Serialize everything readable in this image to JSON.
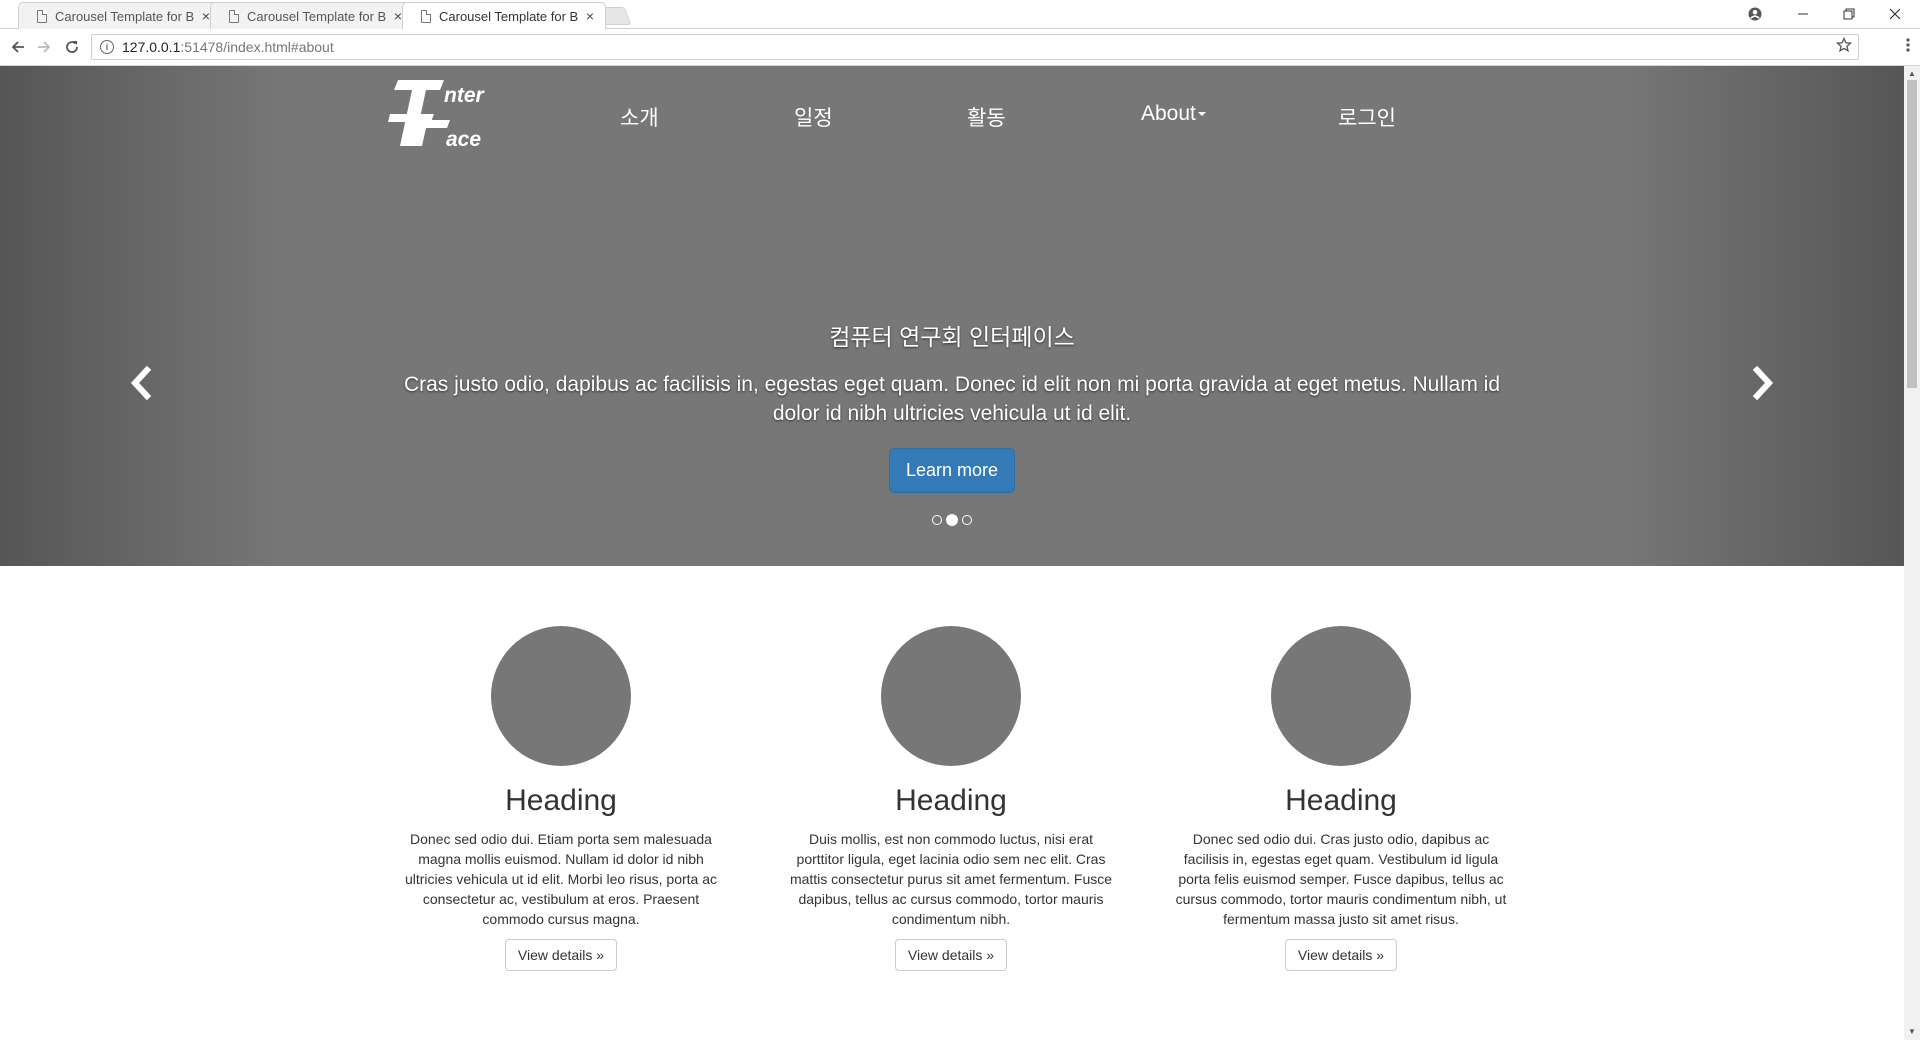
{
  "browser": {
    "tabs": [
      {
        "title": "Carousel Template for B",
        "active": false
      },
      {
        "title": "Carousel Template for B",
        "active": false
      },
      {
        "title": "Carousel Template for B",
        "active": true
      }
    ],
    "tab_close": "×",
    "url_host": "127.0.0.1",
    "url_rest": ":51478/index.html#about",
    "info_glyph": "i",
    "icons": [
      "profile-icon",
      "minimize-icon",
      "restore-icon",
      "close-icon",
      "back-icon",
      "forward-icon",
      "reload-icon",
      "star-icon",
      "menu-icon"
    ]
  },
  "site": {
    "logo_alt": "InterFace",
    "nav": {
      "intro": "소개",
      "schedule": "일정",
      "activity": "활동",
      "about": "About",
      "login": "로그인"
    },
    "carousel": {
      "title": "컴퓨터 연구회 인터페이스",
      "text": "Cras justo odio, dapibus ac facilisis in, egestas eget quam. Donec id elit non mi porta gravida at eget metus. Nullam id dolor id nibh ultricies vehicula ut id elit.",
      "button": "Learn more",
      "slide_count": 3,
      "active_slide": 2,
      "background": "#777777",
      "button_color": "#337ab7"
    },
    "columns": [
      {
        "heading": "Heading",
        "text": "Donec sed odio dui. Etiam porta sem malesuada magna mollis euismod. Nullam id dolor id nibh ultricies vehicula ut id elit. Morbi leo risus, porta ac consectetur ac, vestibulum at eros. Praesent commodo cursus magna.",
        "button": "View details »"
      },
      {
        "heading": "Heading",
        "text": "Duis mollis, est non commodo luctus, nisi erat porttitor ligula, eget lacinia odio sem nec elit. Cras mattis consectetur purus sit amet fermentum. Fusce dapibus, tellus ac cursus commodo, tortor mauris condimentum nibh.",
        "button": "View details »"
      },
      {
        "heading": "Heading",
        "text": "Donec sed odio dui. Cras justo odio, dapibus ac facilisis in, egestas eget quam. Vestibulum id ligula porta felis euismod semper. Fusce dapibus, tellus ac cursus commodo, tortor mauris condimentum nibh, ut fermentum massa justo sit amet risus.",
        "button": "View details »"
      }
    ]
  }
}
